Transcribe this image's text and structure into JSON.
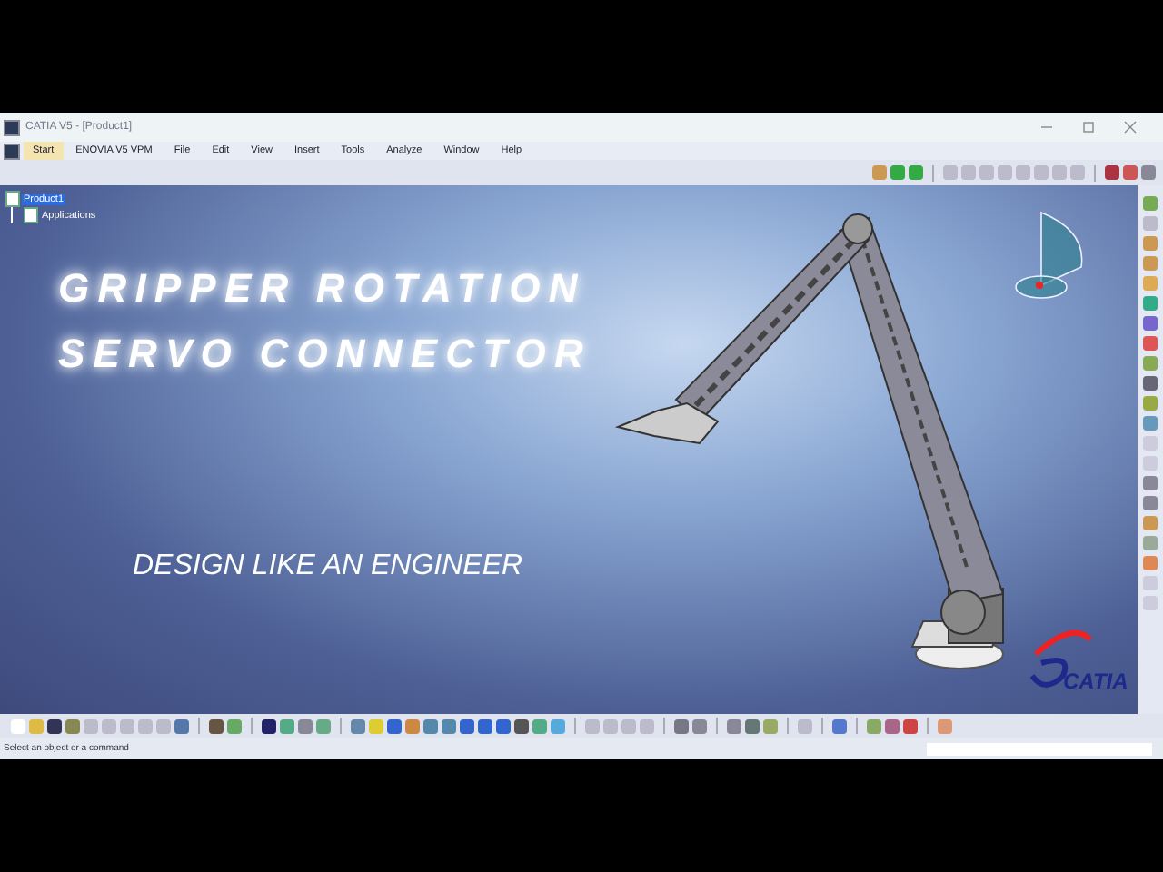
{
  "window": {
    "title": "CATIA V5 - [Product1]"
  },
  "menu": [
    {
      "label": "Start",
      "selected": true
    },
    {
      "label": "ENOVIA V5 VPM",
      "selected": false
    },
    {
      "label": "File",
      "selected": false
    },
    {
      "label": "Edit",
      "selected": false
    },
    {
      "label": "View",
      "selected": false
    },
    {
      "label": "Insert",
      "selected": false
    },
    {
      "label": "Tools",
      "selected": false
    },
    {
      "label": "Analyze",
      "selected": false
    },
    {
      "label": "Window",
      "selected": false
    },
    {
      "label": "Help",
      "selected": false
    }
  ],
  "tree": [
    {
      "label": "Product1",
      "selected": true,
      "children": [
        {
          "label": "Applications",
          "selected": false
        }
      ]
    }
  ],
  "headline": [
    "GRIPPER ROTATION",
    "SERVO CONNECTOR"
  ],
  "tagline": "DESIGN LIKE AN ENGINEER",
  "logo": {
    "text": "CATIA"
  },
  "status_bar": {
    "message": "Select an object or a command"
  }
}
